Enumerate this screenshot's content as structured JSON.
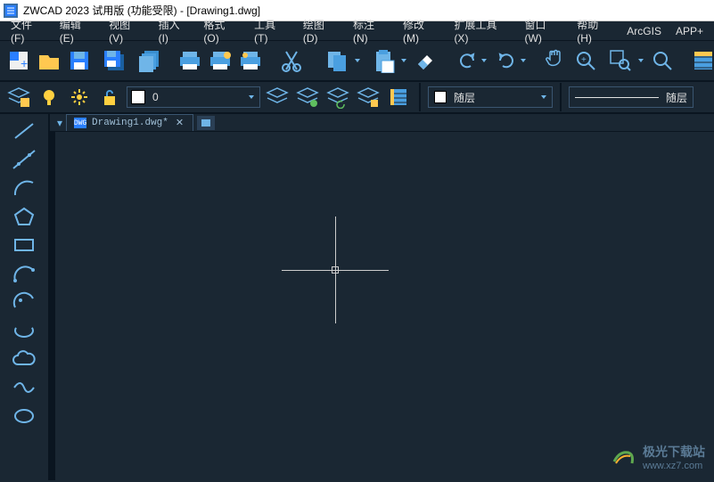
{
  "title": "ZWCAD 2023 试用版 (功能受限) - [Drawing1.dwg]",
  "menus": [
    "文件(F)",
    "编辑(E)",
    "视图(V)",
    "插入(I)",
    "格式(O)",
    "工具(T)",
    "绘图(D)",
    "标注(N)",
    "修改(M)",
    "扩展工具(X)",
    "窗口(W)",
    "帮助(H)",
    "ArcGIS",
    "APP+"
  ],
  "layer": {
    "current_value": "0",
    "color_style_label": "随层",
    "linetype_label": "随层"
  },
  "doc_tab": {
    "label": "Drawing1.dwg*",
    "icon_text": "DWG"
  },
  "watermark": {
    "brand": "极光下载站",
    "url": "www.xz7.com"
  },
  "toolbar_icons": {
    "new": "new-doc-icon",
    "open": "open-folder-icon",
    "save": "save-icon",
    "saveall": "save-all-icon",
    "sheets": "sheets-icon",
    "print1": "print-icon",
    "print2": "print-preview-icon",
    "print3": "publish-icon",
    "cut": "cut-icon",
    "copy": "copy-icon",
    "paste": "paste-icon",
    "eraser": "eraser-icon",
    "undo": "undo-icon",
    "redo": "redo-icon",
    "pan": "pan-icon",
    "zoom_rt": "zoom-realtime-icon",
    "zoom_win": "zoom-window-icon",
    "zoom": "zoom-icon",
    "props": "properties-icon"
  },
  "layer_icons": {
    "layers": "layers-icon",
    "bulb": "bulb-icon",
    "freeze": "freeze-icon",
    "lock": "unlock-icon",
    "stack1": "layer-states-icon",
    "stack2": "layer-iso-icon",
    "stack3": "layer-prev-icon",
    "stack4": "layer-walk-icon",
    "list": "list-icon"
  },
  "draw_tools": [
    "line-tool",
    "xline-tool",
    "polyline-tool",
    "arc-tool",
    "polygon-tool",
    "rectangle-tool",
    "spline-tool",
    "revision-cloud-tool",
    "ellipse-tool",
    "cloud-tool",
    "curve-tool",
    "circle-tool"
  ]
}
